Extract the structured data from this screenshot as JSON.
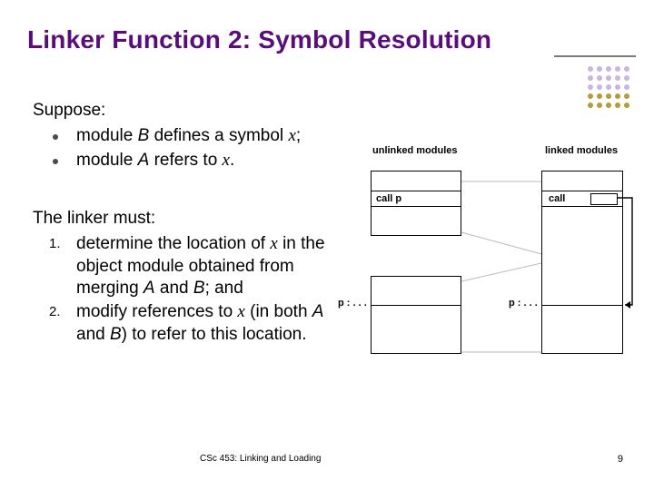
{
  "title": "Linker Function 2: Symbol Resolution",
  "suppose": {
    "lead": "Suppose:",
    "b1_pre": "module ",
    "b1_B": "B",
    "b1_mid": " defines a symbol ",
    "b1_x": "x",
    "b1_post": ";",
    "b2_pre": "module ",
    "b2_A": "A",
    "b2_mid": " refers to ",
    "b2_x": "x",
    "b2_post": "."
  },
  "linker": {
    "lead": "The linker must:",
    "n1_pre": "determine the location of ",
    "n1_x": "x",
    "n1_mid": " in the object module obtained from merging ",
    "n1_A": "A",
    "n1_and": " and ",
    "n1_B": "B",
    "n1_post": "; and",
    "n2_pre": "modify references to ",
    "n2_x": "x",
    "n2_mid1": " (in both ",
    "n2_A": "A",
    "n2_mid2": " and ",
    "n2_B": "B",
    "n2_mid3": ") to refer to this location."
  },
  "diagram": {
    "label_unlinked": "unlinked modules",
    "label_linked": "linked modules",
    "call_p": "call   p",
    "call": "call",
    "p_def": "p : . . ."
  },
  "footer": {
    "course": "CSc 453: Linking and Loading",
    "page": "9"
  }
}
